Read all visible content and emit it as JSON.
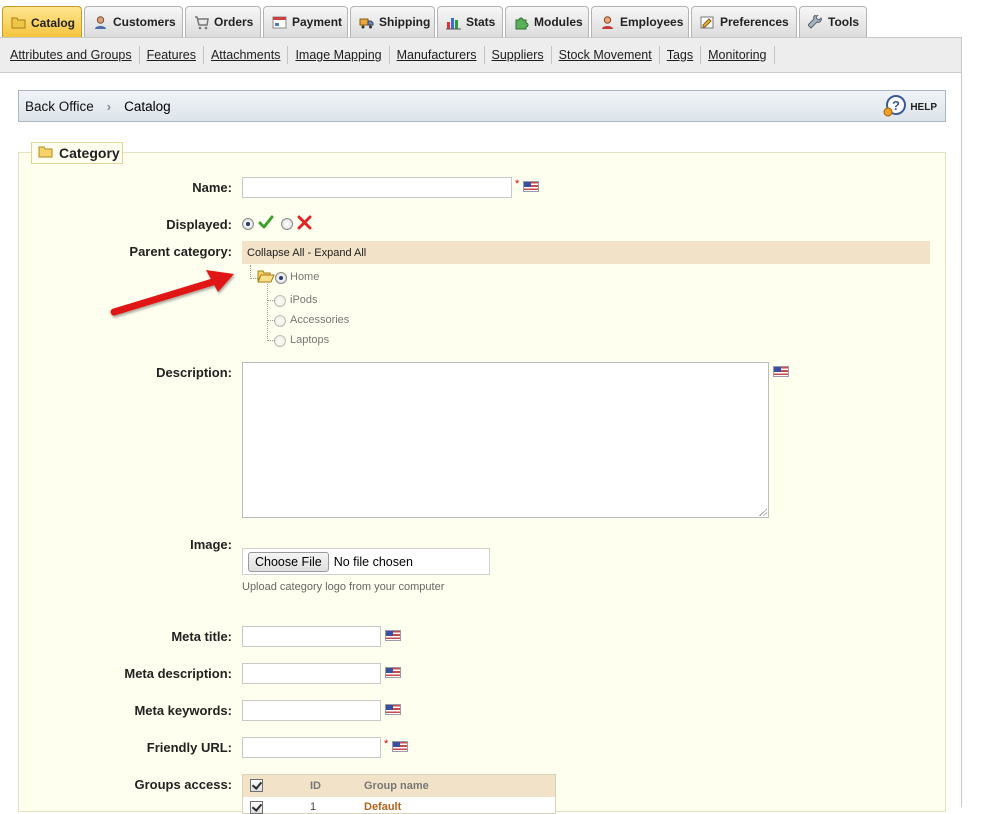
{
  "tabs": [
    {
      "label": "Catalog",
      "icon": "folder-icon",
      "active": true
    },
    {
      "label": "Customers",
      "icon": "user-icon"
    },
    {
      "label": "Orders",
      "icon": "cart-icon"
    },
    {
      "label": "Payment",
      "icon": "payment-icon"
    },
    {
      "label": "Shipping",
      "icon": "truck-icon"
    },
    {
      "label": "Stats",
      "icon": "chart-icon"
    },
    {
      "label": "Modules",
      "icon": "puzzle-icon"
    },
    {
      "label": "Employees",
      "icon": "employee-icon"
    },
    {
      "label": "Preferences",
      "icon": "preferences-icon"
    },
    {
      "label": "Tools",
      "icon": "wrench-icon"
    }
  ],
  "submenu": [
    "Attributes and Groups",
    "Features",
    "Attachments",
    "Image Mapping",
    "Manufacturers",
    "Suppliers",
    "Stock Movement",
    "Tags",
    "Monitoring"
  ],
  "breadcrumb": {
    "home": "Back Office",
    "current": "Catalog",
    "help": "HELP"
  },
  "fieldset": {
    "legend": "Category"
  },
  "form": {
    "name_label": "Name:",
    "name_value": "",
    "required_mark": "*",
    "displayed_label": "Displayed:",
    "displayed_value": "yes",
    "parent_label": "Parent category:",
    "tree_header": "Collapse All - Expand All",
    "tree_items": [
      "Home",
      "iPods",
      "Accessories",
      "Laptops"
    ],
    "tree_selected": "Home",
    "description_label": "Description:",
    "image_label": "Image:",
    "choose_file": "Choose File",
    "no_file": "No file chosen",
    "upload_hint": "Upload category logo from your computer",
    "meta_title_label": "Meta title:",
    "meta_description_label": "Meta description:",
    "meta_keywords_label": "Meta keywords:",
    "friendly_url_label": "Friendly URL:",
    "groups_label": "Groups access:",
    "groups_columns": [
      "ID",
      "Group name"
    ],
    "groups_rows": [
      {
        "id": "1",
        "name": "Default"
      }
    ]
  },
  "colors": {
    "active_tab": "#f6c33b",
    "fieldset_bg": "#ffffef",
    "tree_header_bg": "#f2e2c8",
    "arrow": "#e01818"
  }
}
